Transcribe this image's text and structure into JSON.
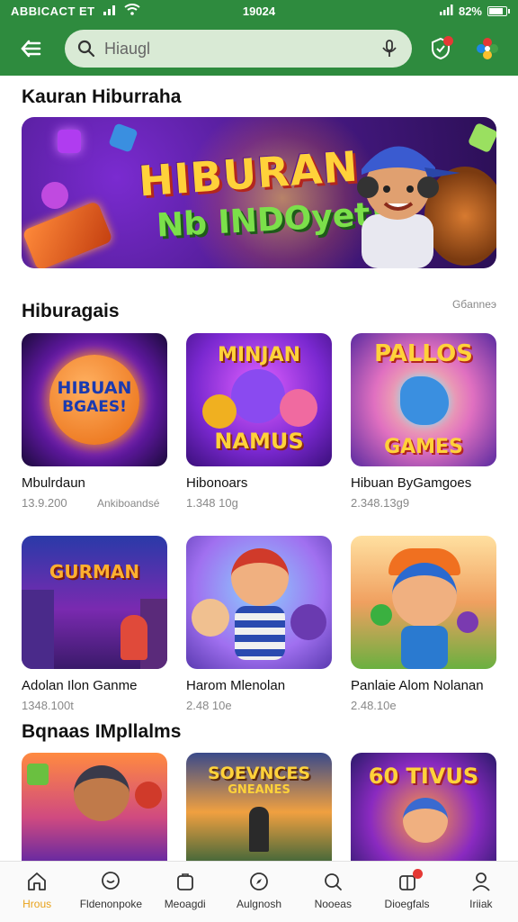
{
  "status_bar": {
    "carrier": "ABBICACT ET",
    "time": "19024",
    "battery": "82%",
    "battery_level": 0.82
  },
  "app_bar": {
    "search_placeholder": "Hiaugl"
  },
  "sections": {
    "featured_title": "Kauran Hiburraha",
    "banner": {
      "line1": "HIBURAN",
      "line2": "Nb INDOyet!"
    },
    "games_title": "Hiburagais",
    "games_see_all": "Gбanneэ",
    "popular_title": "Bqnaas IMpllalms"
  },
  "games_row1": [
    {
      "name": "Mbulrdaun",
      "meta": "13.9.200",
      "meta2": "Ankiboandsé",
      "thumb_line1": "HIBUAN",
      "thumb_line2": "BGAES!"
    },
    {
      "name": "Hibonoars",
      "meta": "1.348 10g",
      "thumb_line1": "MINJAN",
      "thumb_line2": "NAMUS"
    },
    {
      "name": "Hibuan ByGamgoes",
      "meta": "2.348.13g9",
      "thumb_line1": "PALLOS",
      "thumb_line2": "GAMES"
    }
  ],
  "games_row2": [
    {
      "name": "Adolan Ilon Ganme",
      "meta": "1348.100t",
      "thumb_line1": "GURMAN"
    },
    {
      "name": "Harom Mlenolan",
      "meta": "2.48 10e"
    },
    {
      "name": "Panlaie Alom Nolanan",
      "meta": "2.48.10e"
    }
  ],
  "games_row3": [
    {
      "thumb_line1": ""
    },
    {
      "thumb_line1": "SOEVNCES",
      "thumb_line2": "GNEANES"
    },
    {
      "thumb_line1": "60 TIVUS"
    }
  ],
  "bottom_nav": [
    {
      "label": "Hrous",
      "icon": "home-icon",
      "active": true
    },
    {
      "label": "Fldenonpoke",
      "icon": "chat-icon"
    },
    {
      "label": "Meoagdi",
      "icon": "bag-icon"
    },
    {
      "label": "Aulgnosh",
      "icon": "compass-icon"
    },
    {
      "label": "Nooeas",
      "icon": "search-icon"
    },
    {
      "label": "Dioegfals",
      "icon": "gift-icon",
      "badge": true
    },
    {
      "label": "Iriiak",
      "icon": "profile-icon"
    }
  ],
  "colors": {
    "brand_green": "#2e8b3e",
    "search_bg": "#d9ead5",
    "active_nav": "#e8a21a",
    "badge_red": "#e53935"
  }
}
